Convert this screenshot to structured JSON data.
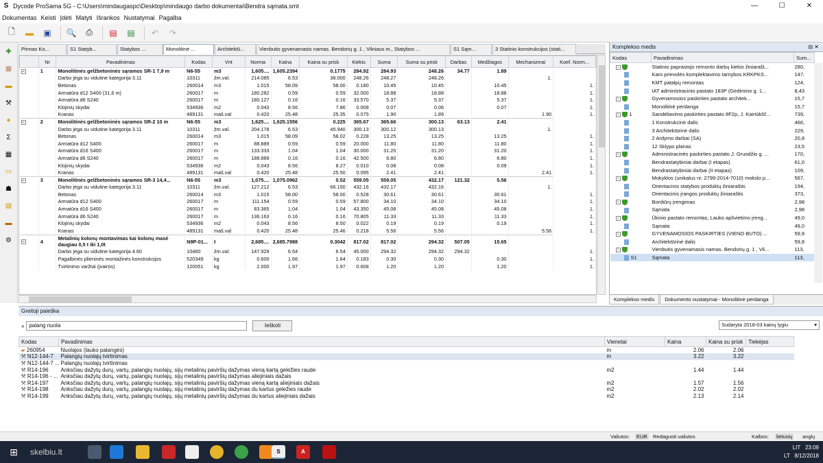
{
  "window": {
    "title": "Dycode ProSama 5G - C:\\Users\\mindaugaspc\\Desktop\\mindaugo darbo dokumentai\\Bendra sąmata.smt",
    "app_icon": "S",
    "minimize": "—",
    "maximize": "☐",
    "close": "✕"
  },
  "menu": [
    "Dokumentas",
    "Keisti",
    "Įdėti",
    "Matyti",
    "Išrankos",
    "Nustatymai",
    "Pagalba"
  ],
  "tabs": [
    "Pirmas Ko...",
    "S1 Statyb...",
    "Statybos ...",
    "Monolitinė ...",
    "Architektū...",
    "Vienbutis gyvenamasis namas. Bendorių g. 1 , Vilniaus m., Statybos ...",
    "S1 Sąm...",
    "3 Statinio konstrukcijos (stati..."
  ],
  "grid": {
    "headers": [
      "",
      "Nr",
      "Pavadinimas",
      "Kodas",
      "Vnt",
      "Norma",
      "Kaina",
      "Kaina su prisk",
      "Kiekis",
      "Suma",
      "Suma su prisk",
      "Darbas",
      "Medžiagos",
      "Mechanizmai",
      "Koef. Norm..."
    ],
    "rows": [
      {
        "g": true,
        "c": [
          "1",
          "Monolitinės gelžbetoninės sąramos SR-1 7,9 m",
          "N6-55",
          "m3",
          "1,605....",
          "1,605.2394",
          "0.1775",
          "284.92",
          "284.93",
          "248.26",
          "34.77",
          "1.89",
          ""
        ]
      },
      {
        "c": [
          "",
          "Darbo jėga su vidutine kategorija 3.11",
          "10311",
          "žm.val.",
          "214.085",
          "6.53",
          "38.000",
          "248.26",
          "248.27",
          "248.26",
          "",
          "",
          "1."
        ]
      },
      {
        "c": [
          "",
          "Betonas",
          "260014",
          "m3",
          "1.015",
          "58.09",
          "58.00",
          "0.180",
          "10.45",
          "10.45",
          "",
          "10.45",
          "",
          "1."
        ]
      },
      {
        "c": [
          "",
          "Armatūra d12 S400 (31,6 m)",
          "260017",
          "m",
          "180.282",
          "0.59",
          "0.59",
          "32.000",
          "18.88",
          "18.88",
          "",
          "18.88",
          "",
          "1."
        ]
      },
      {
        "c": [
          "",
          "Armatūra d6 S240",
          "260017",
          "m",
          "180.127",
          "0.16",
          "0.16",
          "33.570",
          "5.37",
          "5.37",
          "",
          "5.37",
          "",
          "1."
        ]
      },
      {
        "c": [
          "",
          "Klojinių skydai",
          "534936",
          "m2",
          "0.043",
          "8.56",
          "7.86",
          "0.008",
          "0.07",
          "0.06",
          "",
          "0.07",
          "",
          "1."
        ]
      },
      {
        "c": [
          "",
          "Kranas",
          "489131",
          "maš.val",
          "0.420",
          "25.48",
          "25.35",
          "0.075",
          "1.90",
          "1.89",
          "",
          "",
          "1.90",
          "1."
        ]
      },
      {
        "g": true,
        "c": [
          "2",
          "Monolitinės gelžbetoninės sąramos SR-2 10 m",
          "N6-55",
          "m3",
          "1,625....",
          "1,625.1556",
          "0.225",
          "365.67",
          "365.66",
          "300.13",
          "63.13",
          "2.41",
          ""
        ]
      },
      {
        "c": [
          "",
          "Darbo jėga su vidutine kategorija 3.11",
          "10311",
          "žm.val.",
          "204.178",
          "6.53",
          "45.940",
          "300.13",
          "300.12",
          "300.13",
          "",
          "",
          "1."
        ]
      },
      {
        "c": [
          "",
          "Betonas",
          "260014",
          "m3",
          "1.015",
          "58.09",
          "58.02",
          "0.228",
          "13.25",
          "13.25",
          "",
          "13.25",
          "",
          "1."
        ]
      },
      {
        "c": [
          "",
          "Armatūra d12 S400",
          "260017",
          "m",
          "88.889",
          "0.59",
          "0.59",
          "20.000",
          "11.80",
          "11.80",
          "",
          "11.80",
          "",
          "1."
        ]
      },
      {
        "c": [
          "",
          "Armatūra d16 S400",
          "260017",
          "m",
          "133.333",
          "1.04",
          "1.04",
          "30.000",
          "31.20",
          "31.20",
          "",
          "31.20",
          "",
          "1."
        ]
      },
      {
        "c": [
          "",
          "Armatūra d6 S240",
          "260017",
          "m",
          "188.889",
          "0.16",
          "0.16",
          "42.500",
          "6.80",
          "6.80",
          "",
          "6.80",
          "",
          "1."
        ]
      },
      {
        "c": [
          "",
          "Klojinių skydai",
          "534936",
          "m2",
          "0.043",
          "8.56",
          "8.27",
          "0.010",
          "0.08",
          "0.08",
          "",
          "0.09",
          "",
          "1."
        ]
      },
      {
        "c": [
          "",
          "Kranas",
          "489131",
          "maš.val",
          "0.420",
          "25.48",
          "25.50",
          "0.095",
          "2.41",
          "2.41",
          "",
          "",
          "2.41",
          "1."
        ]
      },
      {
        "g": true,
        "c": [
          "3",
          "Monolitinės gelžbetoninės sąramos SR-3 14,4...",
          "N6-55",
          "m3",
          "1,075....",
          "1,075.0962",
          "0.52",
          "559.05",
          "559.05",
          "432.17",
          "121.32",
          "5.56",
          ""
        ]
      },
      {
        "c": [
          "",
          "Darbo jėga su vidutine kategorija 3.11",
          "10311",
          "žm.val.",
          "127.212",
          "6.53",
          "66.150",
          "432.16",
          "432.17",
          "432.16",
          "",
          "",
          "1."
        ]
      },
      {
        "c": [
          "",
          "Betonas",
          "260014",
          "m3",
          "1.015",
          "58.00",
          "58.00",
          "0.528",
          "30.61",
          "30.61",
          "",
          "30.61",
          "",
          "1."
        ]
      },
      {
        "c": [
          "",
          "Armatūra d12 S400",
          "260017",
          "m",
          "111.154",
          "0.59",
          "0.59",
          "57.800",
          "34.10",
          "34.10",
          "",
          "34.10",
          "",
          "1."
        ]
      },
      {
        "c": [
          "",
          "Armatūra d16 S400",
          "260017",
          "m",
          "83.365",
          "1.04",
          "1.04",
          "43.350",
          "45.08",
          "45.08",
          "",
          "45.08",
          "",
          "1."
        ]
      },
      {
        "c": [
          "",
          "Armatūra d6 S240",
          "260017",
          "m",
          "136.163",
          "0.16",
          "0.16",
          "70.805",
          "11.33",
          "11.33",
          "",
          "11.33",
          "",
          "1."
        ]
      },
      {
        "c": [
          "",
          "Klojinių skydai",
          "534936",
          "m2",
          "0.043",
          "8.56",
          "8.50",
          "0.022",
          "0.19",
          "0.19",
          "",
          "0.19",
          "",
          "1."
        ]
      },
      {
        "c": [
          "",
          "Kranas",
          "489131",
          "maš.val",
          "0.420",
          "25.48",
          "25.46",
          "0.218",
          "5.56",
          "5.56",
          "",
          "",
          "5.56",
          "1."
        ]
      },
      {
        "g": true,
        "tall": true,
        "c": [
          "4",
          "Metalinių kolonų montavimas kai kolonų masė daugiau 0,5 t iki 1,0t",
          "N9P-01...",
          "t",
          "2,685....",
          "2,685.7988",
          "0.3042",
          "817.02",
          "817.02",
          "294.32",
          "507.05",
          "15.65",
          ""
        ]
      },
      {
        "c": [
          "",
          "Darbo jėga su vidutine kategorija 4.60",
          "10460",
          "žm.val.",
          "147.929",
          "6.54",
          "6.54",
          "45.000",
          "294.32",
          "294.32",
          "294.32",
          "",
          "",
          "1."
        ]
      },
      {
        "c": [
          "",
          "Pagalbinės plieninės montažinės konstrukcijos",
          "520349",
          "kg",
          "0.600",
          "1.66",
          "1.64",
          "0.183",
          "0.30",
          "0.30",
          "",
          "0.30",
          "",
          "1."
        ]
      },
      {
        "c": [
          "",
          "Tvirtinimo varžtai (įvairūs)",
          "120051",
          "kg",
          "2.000",
          "1.97",
          "1.97",
          "0.608",
          "1.20",
          "1.20",
          "",
          "1.20",
          "",
          "1."
        ]
      }
    ]
  },
  "right_panel": {
    "title": "Komplekso medis",
    "pin": "⊟ ✕",
    "headers": [
      "Kodas",
      "Pavadinimas",
      "Sum..."
    ],
    "rows": [
      {
        "ex": "⊟",
        "ic": "sh",
        "code": "",
        "name": "Statinio paprastojo remonto darbų kiekio žiniarašt...",
        "sum": "280,"
      },
      {
        "ic": "dc",
        "code": "",
        "name": "Karo prievolės komplektavimo tarnybos KRKPKS...",
        "sum": "147,"
      },
      {
        "ic": "dc",
        "code": "",
        "name": "KMT patalpų remontas",
        "sum": "124,"
      },
      {
        "ic": "dc",
        "code": "",
        "name": "IAT administracinio pastato 183P (Gedimino g. 1...",
        "sum": "8,43"
      },
      {
        "ex": "⊟",
        "ic": "sh",
        "code": "",
        "name": "Gyvenamosios paskirties pastato architek...",
        "sum": "15,7"
      },
      {
        "ic": "dc",
        "code": "",
        "name": "Monolitinė perdanga",
        "sum": "15,7"
      },
      {
        "ex": "⊟",
        "ic": "sh",
        "code": "1",
        "name": "Sandėliavimo paskirties pastato 8F2p, J. Kairiūkšč...",
        "sum": "739,"
      },
      {
        "ic": "dc",
        "code": "",
        "name": "1 Konstrukcinė dalis",
        "sum": "466,"
      },
      {
        "ic": "dc",
        "code": "",
        "name": "3 Architektūrinė dalis",
        "sum": "229,"
      },
      {
        "ic": "dc",
        "code": "",
        "name": "2 Ardymo darbai (SA)",
        "sum": "20,8"
      },
      {
        "ic": "dc",
        "code": "",
        "name": "12 Sklypo planas",
        "sum": "23,5"
      },
      {
        "ex": "⊟",
        "ic": "sh",
        "code": "",
        "name": "Administracinės paskirties pastato J. Gruodžio g. ...",
        "sum": "170,"
      },
      {
        "ic": "dc",
        "code": "",
        "name": "Bendrastatybiniai darbai (I etapas)",
        "sum": "61,0"
      },
      {
        "ic": "dc",
        "code": "",
        "name": "Bendrastatybiniai darbai (II etapas)",
        "sum": "109,"
      },
      {
        "ex": "⊟",
        "ic": "sh",
        "code": "",
        "name": "Mokyklos (unikalus nr. 2799-2014-7010) mokslo p...",
        "sum": "567,"
      },
      {
        "ic": "dc",
        "code": "",
        "name": "Orientacinis statybos produktų žiniaraštis",
        "sum": "194,"
      },
      {
        "ic": "dc",
        "code": "",
        "name": "Orientacinis įrangos produktų žiniaraštis",
        "sum": "373,"
      },
      {
        "ex": "⊟",
        "ic": "sh",
        "code": "",
        "name": "Bordiūrų įrengimas",
        "sum": "2,98"
      },
      {
        "ic": "dc",
        "code": "",
        "name": "Sąmata",
        "sum": "2,98"
      },
      {
        "ex": "⊟",
        "ic": "sh",
        "code": "",
        "name": "Ūkinio pastato remontas, Lauko apšvietimo įreng...",
        "sum": "49,0"
      },
      {
        "ic": "dc",
        "code": "",
        "name": "Sąmata",
        "sum": "49,0"
      },
      {
        "ex": "⊟",
        "ic": "sh",
        "code": "",
        "name": "GYVENAMOSIOS PASKIRTIES (VIENO BUTO) ...",
        "sum": "59,8"
      },
      {
        "ic": "dc",
        "code": "",
        "name": "Architektūrinė dalis",
        "sum": "59,8"
      },
      {
        "ex": "⊟",
        "ic": "sh",
        "code": "",
        "name": "Vienbutis gyvenamasis namas. Bendorių g. 1 , Vil...",
        "sum": "113,"
      },
      {
        "ic": "dc",
        "code": "S1",
        "name": "Sąmata",
        "sum": "113,",
        "sel": true
      }
    ],
    "tabs": [
      "Komplekso medis",
      "Dokumento nustatymai - Monolitinė perdanga"
    ]
  },
  "search": {
    "title": "Greitoji paieška",
    "query": "palang nuola",
    "button": "Ieškoti",
    "price_level": "Sudaryta 2018-03 kainų lygiu",
    "headers": [
      "Kodas",
      "Pavadinimas",
      "Vienetai",
      "Kaina",
      "Kaina su prisk",
      "Tiekėjas"
    ],
    "rows": [
      {
        "code": "260954",
        "name": "Nuolajos (lauko palangės)",
        "unit": "m",
        "price": "2.06",
        "price2": "2.06"
      },
      {
        "code": "N12-144-7",
        "name": "Palangių nuolajų tvirtinimas",
        "unit": "m",
        "price": "3.22",
        "price2": "3.22",
        "sel": true
      },
      {
        "code": "N12-144-7 ...",
        "name": "Palangių nuolajų tvirtinimas",
        "unit": "",
        "price": "",
        "price2": ""
      },
      {
        "code": "R14-196",
        "name": "Anksčiau dažytų durų, vartų, palangių nuolajų, sijų metalinių paviršių dažymas vieną kartą geležies raude",
        "unit": "m2",
        "price": "1.44",
        "price2": "1.44"
      },
      {
        "code": "R14-196 - ...",
        "name": "Anksčiau dažytų durų, vartų, palangių nuolajų, sijų metalinių paviršių dažymas aliejiniais dažais",
        "unit": "",
        "price": "",
        "price2": ""
      },
      {
        "code": "R14-197",
        "name": "Anksčiau dažytų durų, vartų, palangių nuolajų, sijų metalinių paviršių dažymas vieną kartą aliejiniais dažais",
        "unit": "m2",
        "price": "1.57",
        "price2": "1.56"
      },
      {
        "code": "R14-198",
        "name": "Anksčiau dažytų durų, vartų, palangių nuolajų, sijų metalinių paviršių dažymas du kartus geležies raude",
        "unit": "m2",
        "price": "2.02",
        "price2": "2.02"
      },
      {
        "code": "R14-199",
        "name": "Anksčiau dažytų durų, vartų, palangių nuolajų, sijų metalinių paviršių dažymas du kartus aliejiniais dažais",
        "unit": "m2",
        "price": "2.13",
        "price2": "2.14"
      }
    ]
  },
  "status": {
    "currency_label": "Valiutos:",
    "currency": "EUR",
    "edit_currency": "Redaguoti valiutos",
    "language_label": "Kalbos:",
    "language": "lietuvių",
    "lang_suffix": "anglų"
  },
  "taskbar": {
    "lang": "LIT",
    "lang2": "LT",
    "time": "23:09",
    "date": "8/12/2018",
    "watermark": "skelbiu.lt"
  }
}
